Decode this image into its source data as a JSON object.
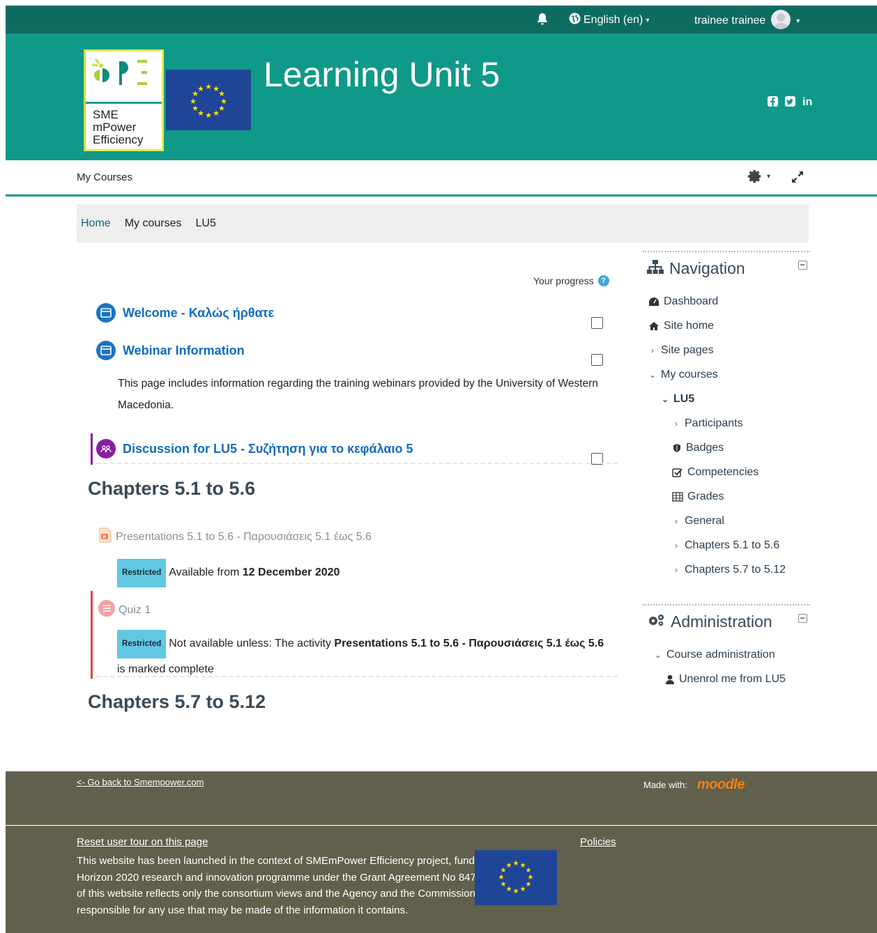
{
  "topbar": {
    "bell_icon": "bell-icon",
    "language": "English (en)",
    "user_name": "trainee trainee"
  },
  "header": {
    "title": "Learning Unit 5",
    "logo_text": [
      "SME",
      "mPower",
      "Efficiency"
    ],
    "social_icons": [
      "facebook-icon",
      "twitter-icon",
      "linkedin-icon"
    ],
    "linkedin_label": "in"
  },
  "subnav": {
    "my_courses": "My Courses"
  },
  "breadcrumb": {
    "items": [
      "Home",
      "My courses",
      "LU5"
    ]
  },
  "main": {
    "progress_label": "Your progress",
    "activities": [
      {
        "title": "Welcome - Καλώς ήρθατε"
      },
      {
        "title": "Webinar Information",
        "description": "This page includes information regarding the training webinars provided by the University of Western Macedonia."
      },
      {
        "title": "Discussion for LU5 - Συζήτηση για το κεφάλαιο 5"
      }
    ],
    "sections": [
      {
        "title": "Chapters 5.1 to 5.6",
        "items": [
          {
            "title": "Presentations 5.1 to 5.6 - Παρουσιάσεις 5.1 έως 5.6",
            "badge": "Restricted",
            "restriction_prefix": "Available from ",
            "restriction_bold": "12 December 2020"
          },
          {
            "title": "Quiz 1",
            "badge": "Restricted",
            "restriction_prefix": "Not available unless: The activity ",
            "restriction_bold": "Presentations 5.1 to 5.6 - Παρουσιάσεις 5.1 έως 5.6",
            "restriction_suffix": " is marked complete"
          }
        ]
      },
      {
        "title": "Chapters 5.7 to 5.12"
      }
    ]
  },
  "sidebar": {
    "navigation": {
      "title": "Navigation",
      "items": [
        {
          "label": "Dashboard"
        },
        {
          "label": "Site home"
        },
        {
          "label": "Site pages"
        },
        {
          "label": "My courses"
        },
        {
          "label": "LU5"
        },
        {
          "label": "Participants"
        },
        {
          "label": "Badges"
        },
        {
          "label": "Competencies"
        },
        {
          "label": "Grades"
        },
        {
          "label": "General"
        },
        {
          "label": "Chapters 5.1 to 5.6"
        },
        {
          "label": "Chapters 5.7 to 5.12"
        }
      ]
    },
    "administration": {
      "title": "Administration",
      "items": [
        {
          "label": "Course administration"
        },
        {
          "label": "Unenrol me from LU5"
        }
      ]
    }
  },
  "footer": {
    "go_back": "<- Go back to Smempower.com",
    "made_with": "Made with:",
    "moodle": "moodle",
    "reset_tour": "Reset user tour on this page",
    "disclaimer": "This website has been launched in the context of SMEmPower Efficiency project, funded by the EU Horizon 2020 research and innovation programme under the Grant Agreement No 847132. The content of this website reflects only the consortium views and the Agency and the Commission are not responsible for any use that may be made of the information it contains.",
    "policies": "Policies"
  },
  "colors": {
    "topbar": "#0e6b60",
    "header": "#0f9989",
    "link": "#0f6cbf",
    "footer": "#60604c",
    "restricted_badge": "#61c7e2",
    "eu_blue": "#1f4596"
  }
}
